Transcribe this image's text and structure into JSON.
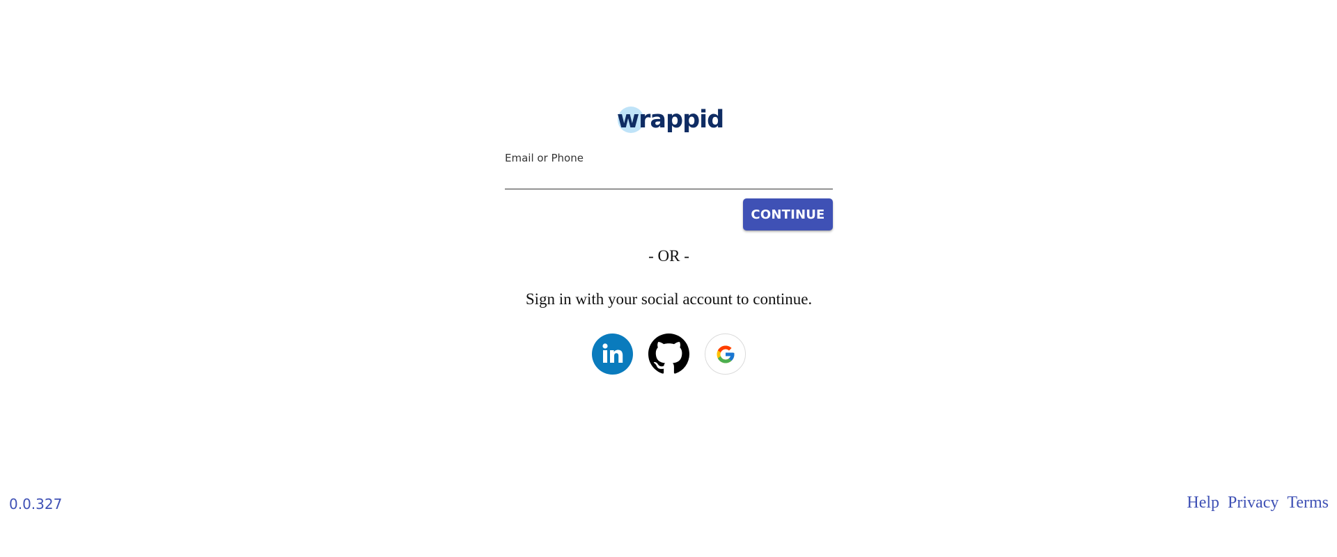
{
  "brand": {
    "logo_text": "wrappid",
    "logo_color": "#0f2c63",
    "logo_bubble_color": "#bfe3f8"
  },
  "login": {
    "email_label": "Email or Phone",
    "email_value": "",
    "continue_label": "CONTINUE",
    "accent_color": "#3f51b5",
    "or_text": "- OR -",
    "social_prompt": "Sign in with your social account to continue."
  },
  "social": [
    {
      "name": "linkedin-icon",
      "color": "#0a7bbd"
    },
    {
      "name": "github-icon",
      "color": "#000000"
    },
    {
      "name": "google-icon",
      "color": "#4285f4"
    }
  ],
  "footer": {
    "version": "0.0.327",
    "links": [
      "Help",
      "Privacy",
      "Terms"
    ]
  }
}
